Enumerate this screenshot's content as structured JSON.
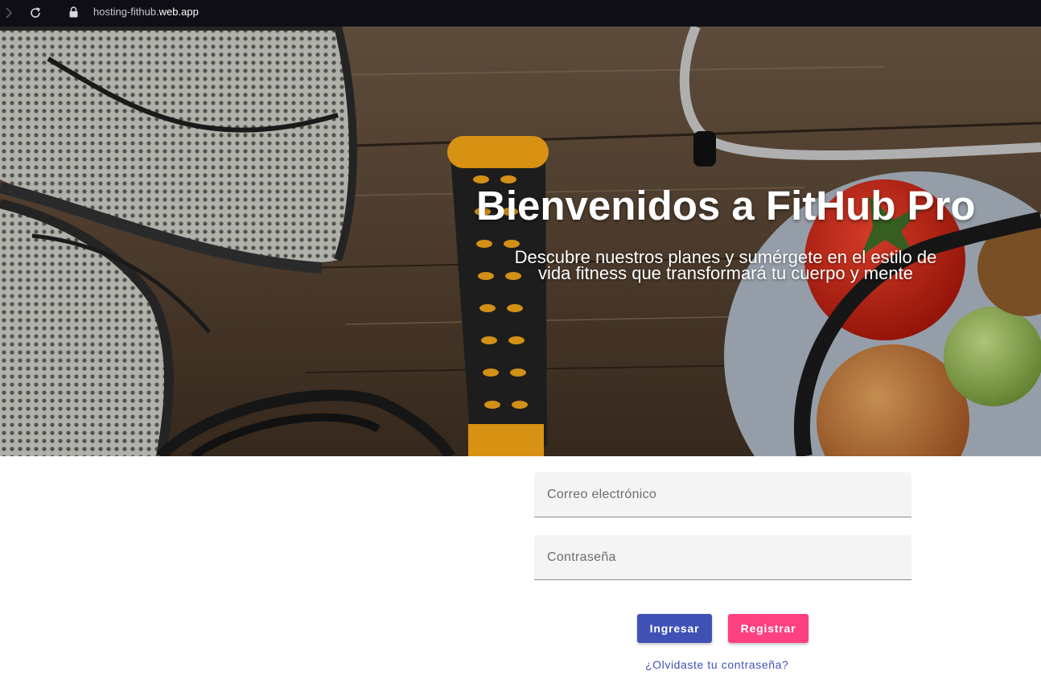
{
  "browser": {
    "url_prefix": "hosting-fithub.",
    "url_domain": "web.app"
  },
  "hero": {
    "title": "Bienvenidos a FitHub Pro",
    "subtitle": "Descubre nuestros planes y sumérgete en el estilo de vida fitness que transformará tu cuerpo y mente"
  },
  "login_form": {
    "email_placeholder": "Correo electrónico",
    "password_placeholder": "Contraseña",
    "login_label": "Ingresar",
    "register_label": "Registrar",
    "forgot_label": "¿Olvidaste tu contraseña?"
  },
  "colors": {
    "primary": "#3f51b5",
    "accent": "#ff4081",
    "browser_bar": "#0f0e17"
  },
  "icons": {
    "forward": "chevron-right-icon",
    "reload": "reload-icon",
    "lock": "lock-icon"
  }
}
